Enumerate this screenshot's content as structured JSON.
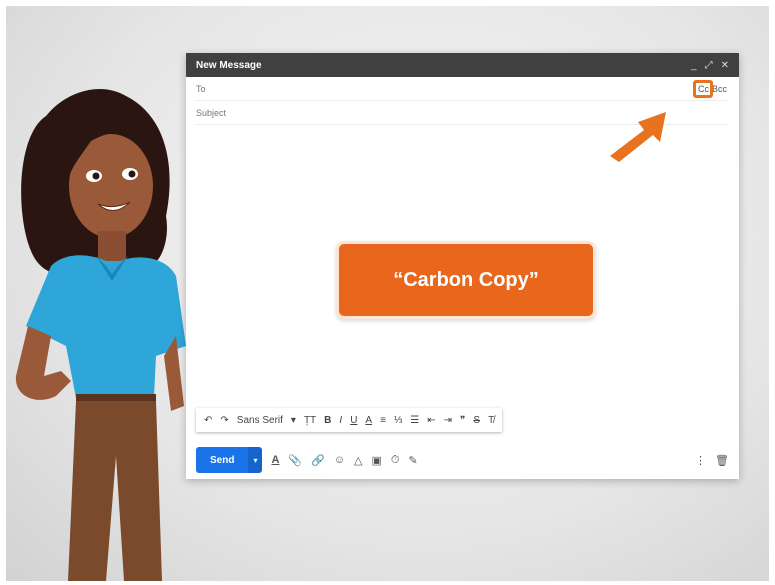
{
  "window": {
    "title": "New Message",
    "minimize": "_",
    "expand": "⤢",
    "close": "✕"
  },
  "fields": {
    "to_label": "To",
    "cc_label": "Cc",
    "bcc_label": "Bcc",
    "subject_label": "Subject"
  },
  "callout": {
    "text": "“Carbon Copy”"
  },
  "formatting": {
    "undo": "↶",
    "redo": "↷",
    "font": "Sans Serif",
    "font_caret": "▾",
    "size": "T̩T",
    "bold": "B",
    "italic": "I",
    "underline": "U",
    "text_color": "A",
    "align": "≡",
    "numbered_list": "⅓",
    "bulleted_list": "☰",
    "indent_less": "⇤",
    "indent_more": "⇥",
    "quote": "❞",
    "strikethrough": "S",
    "clear_format": "T̸"
  },
  "bottom": {
    "send": "Send",
    "send_caret": "▾",
    "format": "A",
    "attach": "📎",
    "link": "🔗",
    "emoji": "☺",
    "drive": "△",
    "photo": "▣",
    "confidential": "⏱",
    "signature": "✎",
    "more": "⋮",
    "discard": "🗑"
  },
  "colors": {
    "accent": "#e8731e",
    "send": "#1a73e8",
    "titlebar": "#404040"
  }
}
